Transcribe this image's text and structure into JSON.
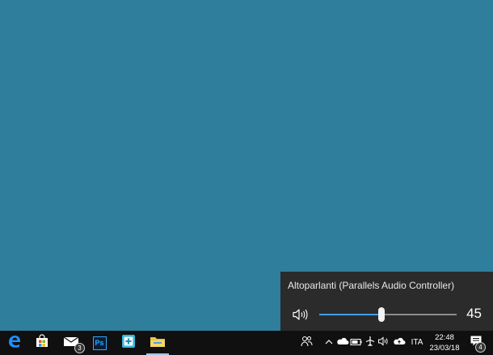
{
  "volume_flyout": {
    "device_name": "Altoparlanti (Parallels Audio Controller)",
    "volume": 45,
    "volume_fraction": 0.45,
    "accent_color": "#3ea0e8",
    "speaker_icon": "speaker-icon"
  },
  "taskbar": {
    "apps": [
      {
        "name": "Microsoft Edge",
        "icon": "edge-icon"
      },
      {
        "name": "Microsoft Store",
        "icon": "store-icon"
      },
      {
        "name": "Mail",
        "icon": "mail-icon",
        "badge": "3"
      },
      {
        "name": "Photoshop",
        "icon": "photoshop-icon",
        "label": "Ps"
      },
      {
        "name": "App",
        "icon": "plus-app-icon"
      },
      {
        "name": "File Explorer",
        "icon": "folder-icon",
        "active": true
      }
    ],
    "tray_icons": [
      "people-icon",
      "chevron-up-icon",
      "onedrive-icon",
      "battery-icon",
      "airplane-icon",
      "volume-icon",
      "cloud-icon"
    ],
    "language": "ITA",
    "time": "22:48",
    "date": "23/03/18",
    "notifications_badge": "4"
  },
  "colors": {
    "desktop": "#2e7e9c",
    "taskbar": "#101010",
    "flyout": "#2b2b2b"
  }
}
